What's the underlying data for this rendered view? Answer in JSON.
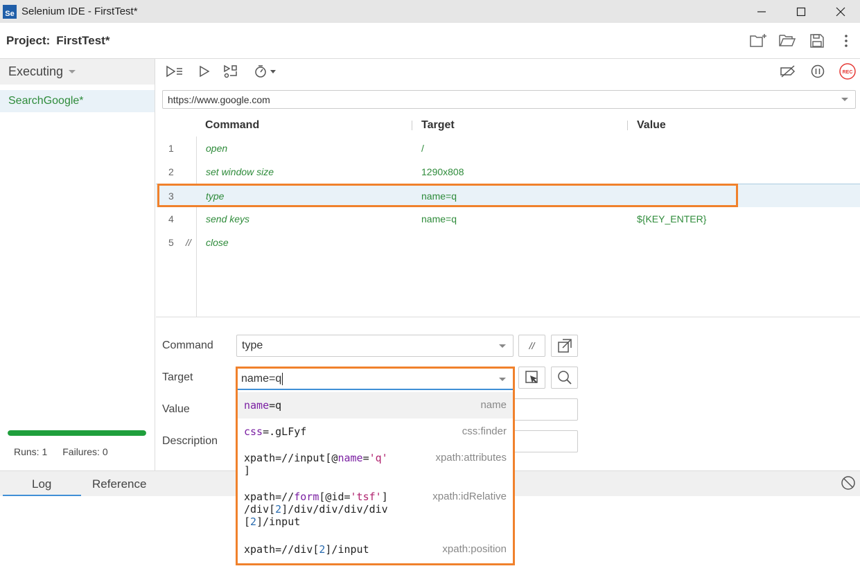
{
  "window": {
    "title": "Selenium IDE - FirstTest*",
    "logo_text": "Se"
  },
  "project": {
    "label": "Project:",
    "name": "FirstTest*"
  },
  "sidebar": {
    "header": "Executing",
    "tests": [
      {
        "label": "SearchGoogle*"
      }
    ],
    "progress": 1.0,
    "runs": "Runs: 1",
    "failures": "Failures: 0"
  },
  "url": "https://www.google.com",
  "table": {
    "headers": {
      "command": "Command",
      "target": "Target",
      "value": "Value"
    },
    "rows": [
      {
        "num": "1",
        "comment": "",
        "command": "open",
        "target": "/",
        "value": ""
      },
      {
        "num": "2",
        "comment": "",
        "command": "set window size",
        "target": "1290x808",
        "value": ""
      },
      {
        "num": "3",
        "comment": "",
        "command": "type",
        "target": "name=q",
        "value": ""
      },
      {
        "num": "4",
        "comment": "",
        "command": "send keys",
        "target": "name=q",
        "value": "${KEY_ENTER}"
      },
      {
        "num": "5",
        "comment": "//",
        "command": "close",
        "target": "",
        "value": ""
      }
    ],
    "selected_row": 3
  },
  "editor": {
    "command_label": "Command",
    "command_value": "type",
    "comment_toggle": "//",
    "target_label": "Target",
    "target_value": "name=q",
    "value_label": "Value",
    "description_label": "Description"
  },
  "autocomplete": {
    "items": [
      {
        "type": "name"
      },
      {
        "type": "css:finder"
      },
      {
        "type": "xpath:attributes"
      },
      {
        "type": "xpath:idRelative"
      },
      {
        "type": "xpath:position"
      }
    ]
  },
  "bottom": {
    "tabs": [
      {
        "label": "Log"
      },
      {
        "label": "Reference"
      }
    ],
    "active_tab": "Log"
  },
  "colors": {
    "accent_green": "#2e8b3a",
    "highlight_orange": "#f0812c",
    "rec_red": "#e53935",
    "selection_blue": "#3f8fd6"
  }
}
